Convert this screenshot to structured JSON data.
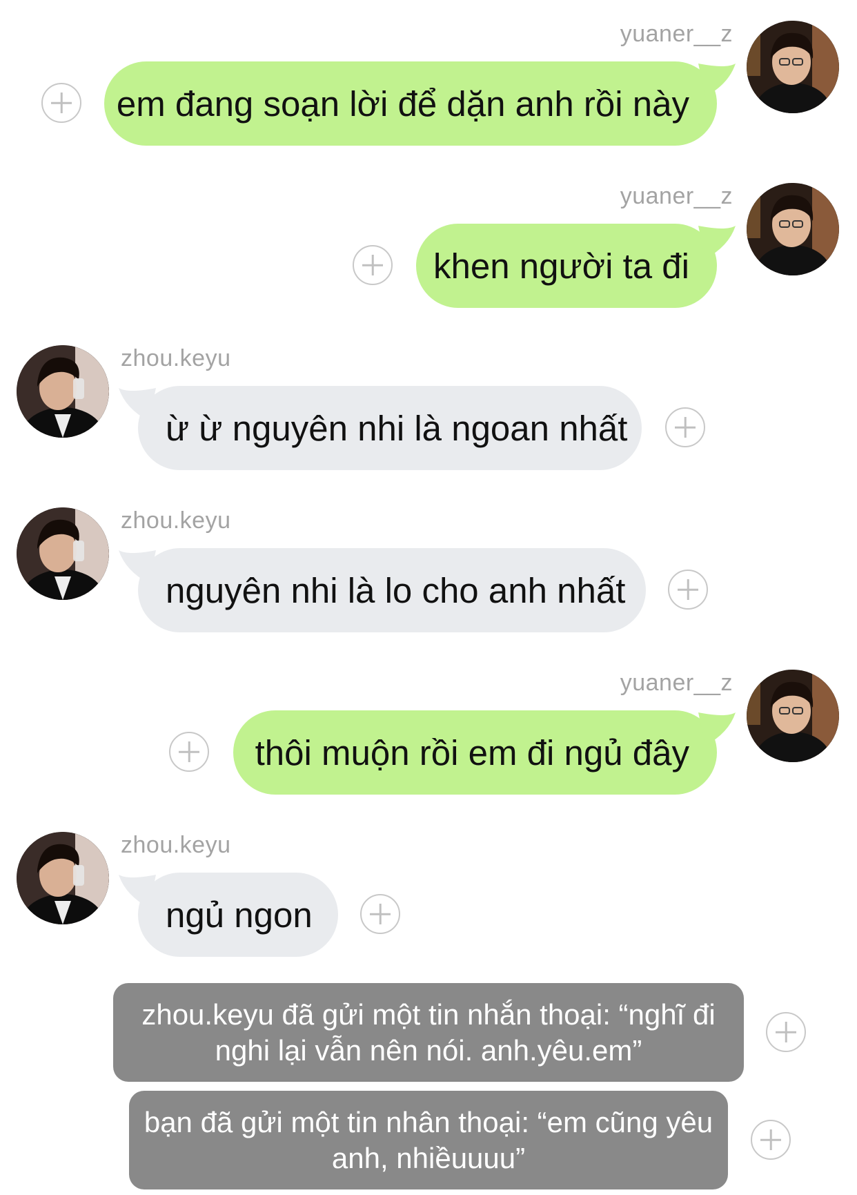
{
  "messages": [
    {
      "sender": "yuaner__z",
      "text": "em đang soạn lời để dặn anh rồi này"
    },
    {
      "sender": "yuaner__z",
      "text": "khen người ta đi"
    },
    {
      "sender": "zhou.keyu",
      "text": "ừ ừ nguyên nhi là ngoan nhất"
    },
    {
      "sender": "zhou.keyu",
      "text": "nguyên nhi là lo cho anh nhất"
    },
    {
      "sender": "yuaner__z",
      "text": "thôi muộn rồi em đi ngủ đây"
    },
    {
      "sender": "zhou.keyu",
      "text": "ngủ ngon"
    }
  ],
  "system_messages": [
    {
      "text": "zhou.keyu đã gửi một tin nhắn thoại: “nghĩ đi nghi lại vẫn nên nói. anh.yêu.em”"
    },
    {
      "text": "bạn đã gửi một tin nhân thoại: “em cũng yêu anh, nhiềuuuu”"
    }
  ],
  "colors": {
    "sent_bubble": "#c1f28f",
    "received_bubble": "#e9ebee",
    "system_bubble": "#898989"
  },
  "icons": {
    "add": "plus-circle-icon",
    "avatar": "user-avatar-photo"
  }
}
